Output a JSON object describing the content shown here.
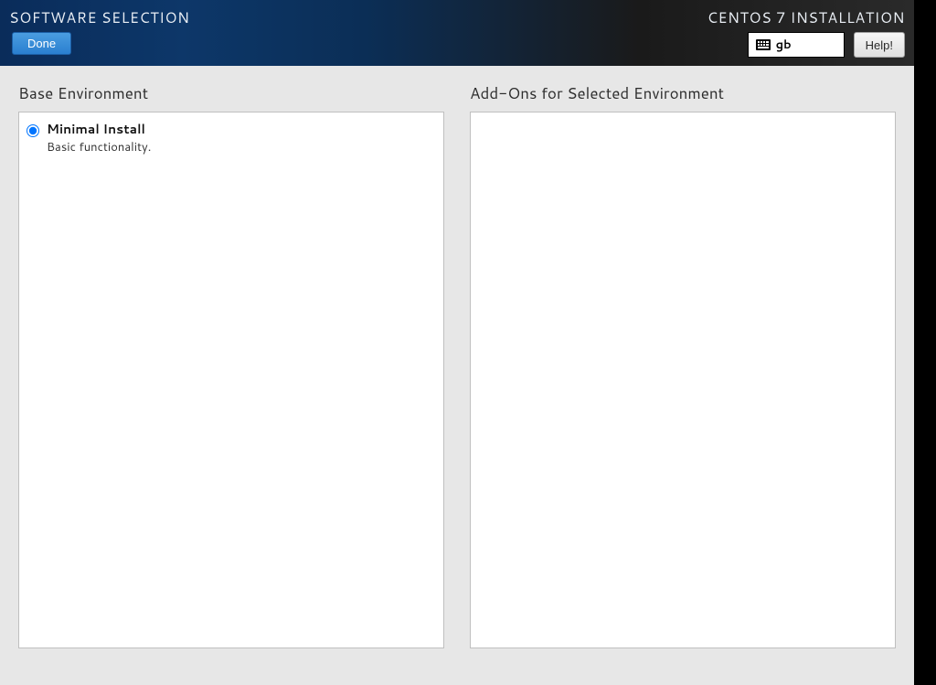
{
  "header": {
    "page_title": "SOFTWARE SELECTION",
    "done_label": "Done",
    "installer_title": "CENTOS 7 INSTALLATION",
    "keyboard_layout": "gb",
    "help_label": "Help!"
  },
  "panels": {
    "base_heading": "Base Environment",
    "addons_heading": "Add-Ons for Selected Environment"
  },
  "environments": [
    {
      "name": "Minimal Install",
      "description": "Basic functionality.",
      "selected": true
    }
  ],
  "addons": []
}
